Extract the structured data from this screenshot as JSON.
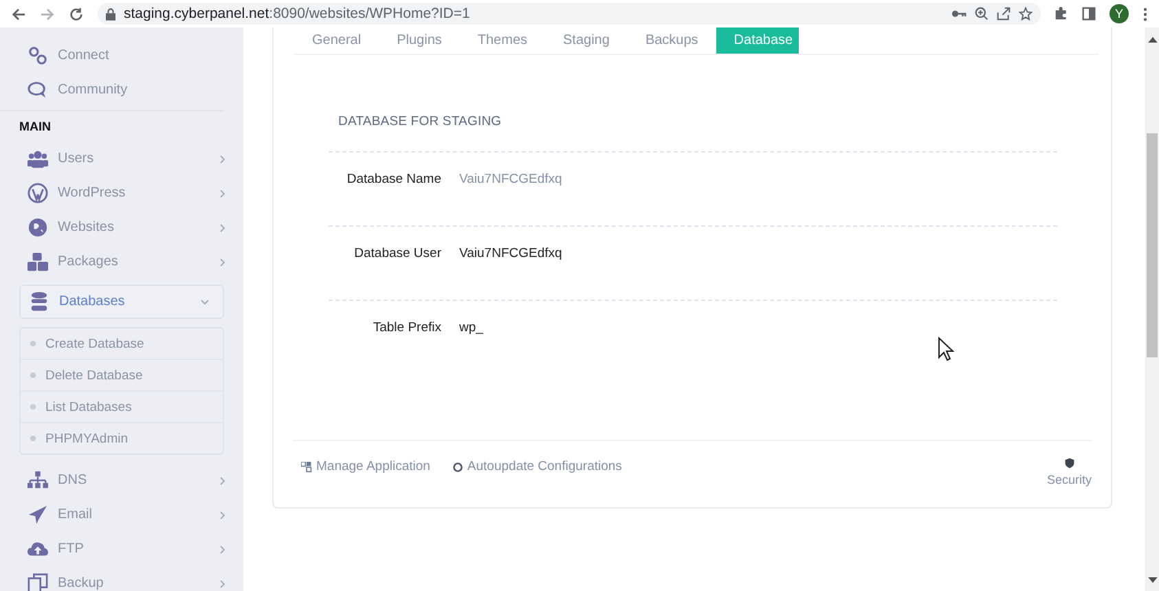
{
  "browser": {
    "url_host": "staging.cyberpanel.net",
    "url_rest": ":8090/websites/WPHome?ID=1",
    "avatar": "Y"
  },
  "sidebar": [
    {
      "kind": "link",
      "label": "Connect"
    },
    {
      "kind": "link",
      "label": "Community"
    },
    {
      "kind": "heading",
      "label": "MAIN"
    },
    {
      "kind": "menu",
      "label": "Users",
      "expanded": false,
      "selected": false
    },
    {
      "kind": "menu",
      "label": "WordPress",
      "expanded": false,
      "selected": false
    },
    {
      "kind": "menu",
      "label": "Websites",
      "expanded": false,
      "selected": false
    },
    {
      "kind": "menu",
      "label": "Packages",
      "expanded": false,
      "selected": false
    },
    {
      "kind": "menu",
      "label": "Databases",
      "expanded": true,
      "selected": true,
      "children": [
        {
          "label": "Create Database"
        },
        {
          "label": "Delete Database"
        },
        {
          "label": "List Databases"
        },
        {
          "label": "PHPMYAdmin"
        }
      ]
    },
    {
      "kind": "menu",
      "label": "DNS",
      "expanded": false,
      "selected": false
    },
    {
      "kind": "menu",
      "label": "Email",
      "expanded": false,
      "selected": false
    },
    {
      "kind": "menu",
      "label": "FTP",
      "expanded": false,
      "selected": false
    },
    {
      "kind": "menu",
      "label": "Backup",
      "expanded": false,
      "selected": false
    }
  ],
  "tabs": [
    {
      "label": "General",
      "selected": false
    },
    {
      "label": "Plugins",
      "selected": false
    },
    {
      "label": "Themes",
      "selected": false
    },
    {
      "label": "Staging",
      "selected": false
    },
    {
      "label": "Backups",
      "selected": false
    },
    {
      "label": "Database",
      "selected": true
    }
  ],
  "section_title": "DATABASE FOR STAGING",
  "fields": [
    {
      "label": "Database Name",
      "value": "Vaiu7NFCGEdfxq",
      "muted": true
    },
    {
      "label": "Database User",
      "value": "Vaiu7NFCGEdfxq",
      "muted": false
    },
    {
      "label": "Table Prefix",
      "value": "wp_",
      "muted": false
    }
  ],
  "footer_links": [
    {
      "label": "Manage Application"
    },
    {
      "label": "Autoupdate Configurations"
    }
  ],
  "security": {
    "label": "Security"
  }
}
